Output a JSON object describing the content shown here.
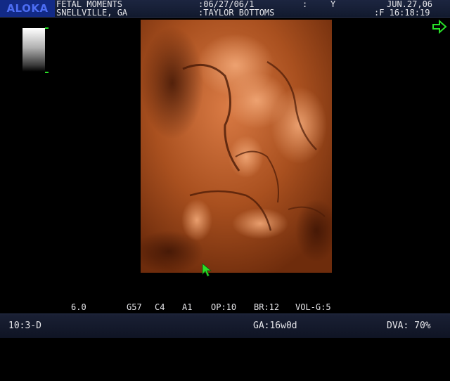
{
  "header": {
    "brand": "ALOKA",
    "institution": "FETAL MOMENTS",
    "location": "SNELLVILLE, GA",
    "patient_id": ":06/27/06/1",
    "patient_flag_sep": ":",
    "patient_flag": "Y",
    "patient_name": ":TAYLOR BOTTOMS",
    "date": "JUN.27,06",
    "frame_time": ":F 16:18:19"
  },
  "params": {
    "depth": "6.0",
    "gain": "G57",
    "contrast": "C4",
    "acoustic": "A1",
    "opacity": "OP:10",
    "brightness": "BR:12",
    "volume_gain": "VOL-G:5"
  },
  "footer": {
    "mode": "10:3-D",
    "gestational_age": "GA:16w0d",
    "dva": "DVA: 70%"
  },
  "icons": {
    "freeze": "arrow-right-icon",
    "pointer": "cursor-icon"
  },
  "colors": {
    "accent_green": "#28e028",
    "logo_blue": "#4c6df3",
    "sepia": "#a84a1c"
  }
}
